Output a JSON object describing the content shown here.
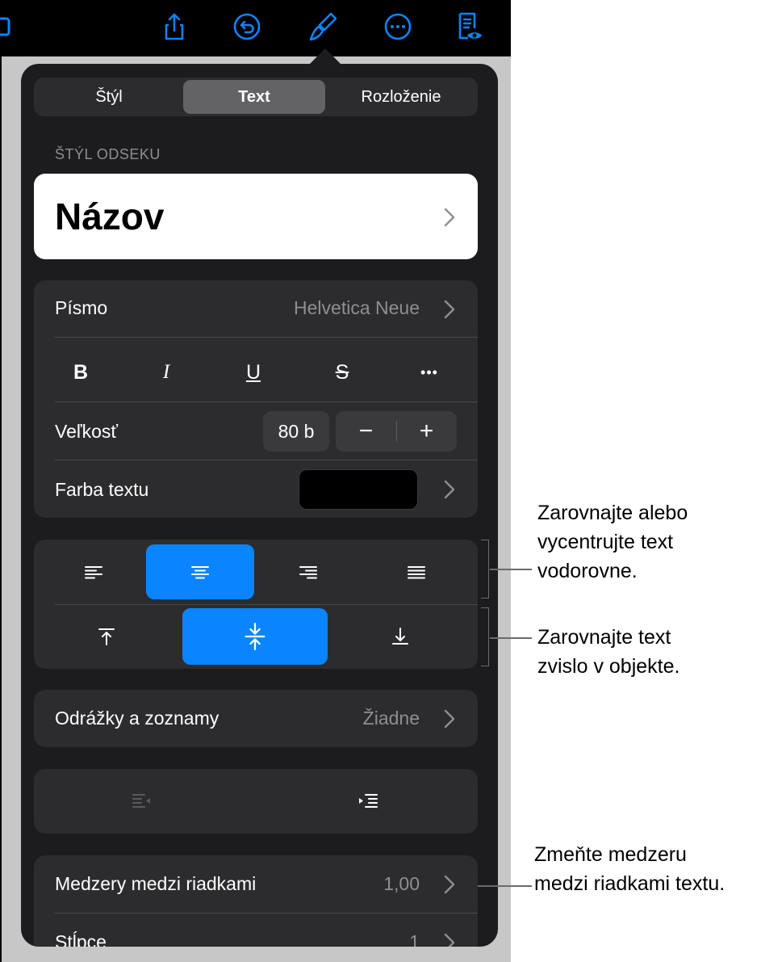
{
  "tabs": [
    {
      "label": "Štýl",
      "active": false
    },
    {
      "label": "Text",
      "active": true
    },
    {
      "label": "Rozloženie",
      "active": false
    }
  ],
  "section_label": "ŠTÝL ODSEKU",
  "paragraph_style": "Názov",
  "font": {
    "label": "Písmo",
    "value": "Helvetica Neue"
  },
  "format_buttons": [
    {
      "label": "B",
      "name": "bold"
    },
    {
      "label": "I",
      "name": "italic"
    },
    {
      "label": "U",
      "name": "underline"
    },
    {
      "label": "S",
      "name": "strikethrough"
    },
    {
      "label": "•••",
      "name": "more"
    }
  ],
  "size": {
    "label": "Veľkosť",
    "value": "80 b",
    "minus": "−",
    "plus": "+"
  },
  "text_color": {
    "label": "Farba textu",
    "color": "#000000"
  },
  "horizontal_align": {
    "options": [
      "left",
      "center",
      "right",
      "justify"
    ],
    "selected": "center"
  },
  "vertical_align": {
    "options": [
      "top",
      "middle",
      "bottom"
    ],
    "selected": "middle"
  },
  "bullets": {
    "label": "Odrážky a zoznamy",
    "value": "Žiadne"
  },
  "line_spacing": {
    "label": "Medzery medzi riadkami",
    "value": "1,00"
  },
  "columns": {
    "label": "Stĺpce",
    "value": "1"
  },
  "colors": {
    "accent": "#0a84ff",
    "panel": "#1c1c1e",
    "group": "#2c2c2e",
    "secondary_text": "#8e8e93"
  },
  "callouts": {
    "horizontal": [
      "Zarovnajte alebo",
      "vycentrujte text",
      "vodorovne."
    ],
    "vertical": [
      "Zarovnajte text",
      "zvislo v objekte."
    ],
    "spacing": [
      "Zmeňte medzeru",
      "medzi riadkami textu."
    ]
  }
}
